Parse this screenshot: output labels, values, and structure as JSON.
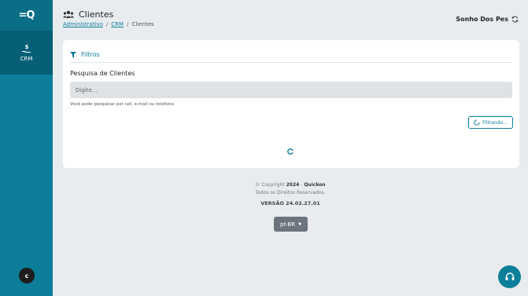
{
  "sidebar": {
    "logo_text": "=Q",
    "crm_label": "CRM",
    "avatar_initial": "c"
  },
  "header": {
    "title": "Clientes",
    "breadcrumb": [
      "Administrativo",
      "CRM",
      "Clientes"
    ],
    "store_name": "Sonho Dos Pes"
  },
  "filters": {
    "title": "Filtros",
    "search_label": "Pesquisa de Clientes",
    "search_placeholder": "Digite...",
    "search_value": "",
    "hint": "Você pode pesquisar por cpf, e-mail ou telefone.",
    "filter_button_label": "Filtrando..."
  },
  "footer": {
    "copyright_prefix": "© Copyright",
    "year": "2024",
    "dash": "-",
    "company": "Quickon",
    "rights": "Todos os Direitos Reservados.",
    "version": "VERSÃO 24.02.27.01",
    "language": "pt-BR"
  },
  "colors": {
    "brand": "#0c7e9a",
    "sidebar_dark": "#075f75",
    "background": "#e9ecef"
  },
  "icons": {
    "users": "users-icon",
    "filter": "filter-icon",
    "sync": "sync-icon",
    "spinner": "spinner-icon",
    "help": "headset-icon",
    "crm": "money-hand-icon"
  }
}
